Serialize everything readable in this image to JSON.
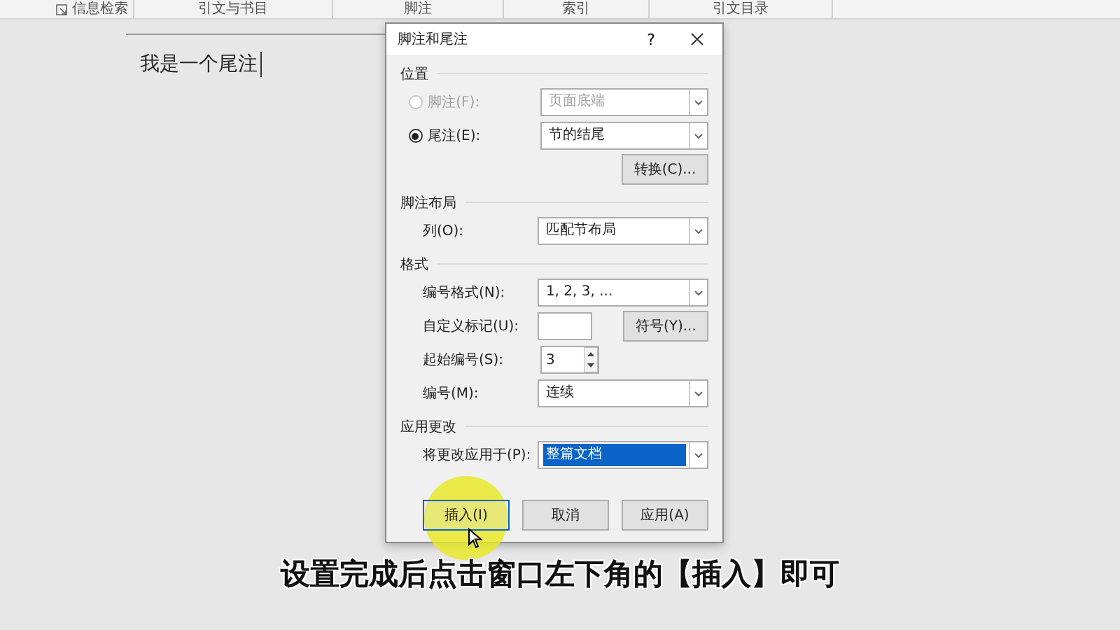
{
  "ribbon_groups": [
    {
      "label": "信息检索",
      "launcher": true
    },
    {
      "label": "引文与书目",
      "launcher": false
    },
    {
      "label": "脚注",
      "launcher": false
    },
    {
      "label": "索引",
      "launcher": false
    },
    {
      "label": "引文目录",
      "launcher": false
    }
  ],
  "document": {
    "text": "我是一个尾注"
  },
  "dialog": {
    "title": "脚注和尾注",
    "help": "?",
    "sections": [
      {
        "title": "位置",
        "rows": [
          {
            "kind": "radio",
            "label": "脚注(F):",
            "selected": false,
            "disabled": true,
            "value": "页面底端"
          },
          {
            "kind": "radio",
            "label": "尾注(E):",
            "selected": true,
            "disabled": false,
            "value": "节的结尾"
          },
          {
            "kind": "button",
            "label": "转换(C)..."
          }
        ]
      },
      {
        "title": "脚注布局",
        "rows": [
          {
            "kind": "select",
            "label": "列(O):",
            "value": "匹配节布局",
            "highlighted": false
          }
        ]
      },
      {
        "title": "格式",
        "rows": [
          {
            "kind": "select",
            "label": "编号格式(N):",
            "value": "1, 2, 3, ...",
            "highlighted": false
          },
          {
            "kind": "mark",
            "label": "自定义标记(U):",
            "button": "符号(Y)..."
          },
          {
            "kind": "spin",
            "label": "起始编号(S):",
            "value": "3"
          },
          {
            "kind": "select",
            "label": "编号(M):",
            "value": "连续",
            "highlighted": false
          }
        ]
      },
      {
        "title": "应用更改",
        "rows": [
          {
            "kind": "select",
            "label": "将更改应用于(P):",
            "value": "整篇文档",
            "highlighted": true
          }
        ]
      }
    ],
    "buttons": [
      {
        "label": "插入(I)",
        "focused": true
      },
      {
        "label": "取消",
        "focused": false
      },
      {
        "label": "应用(A)",
        "focused": false
      }
    ]
  },
  "caption": "设置完成后点击窗口左下角的【插入】即可"
}
